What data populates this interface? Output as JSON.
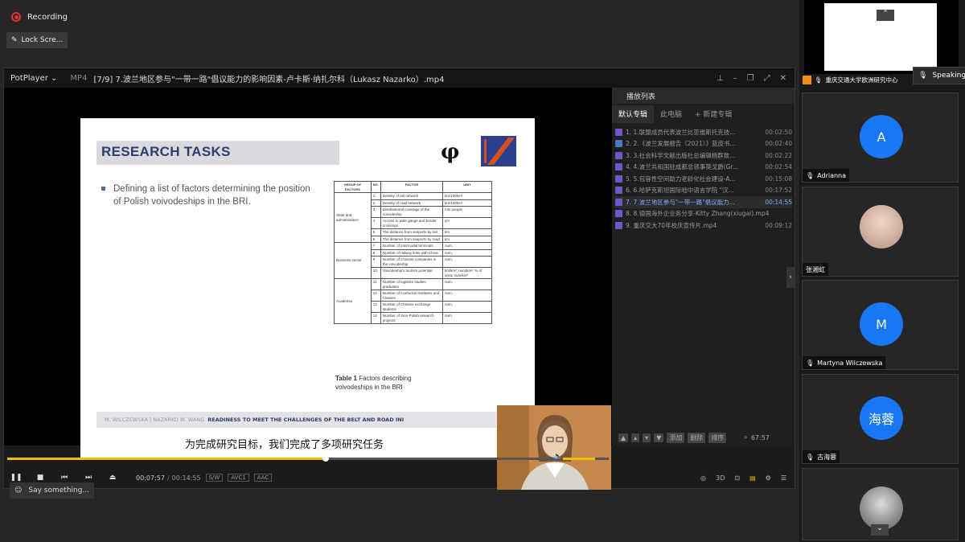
{
  "meeting": {
    "recording_label": "Recording",
    "lock_label": "Lock Scre...",
    "say_placeholder": "Say something...",
    "speaking_label": "Speaking"
  },
  "player": {
    "app_name": "PotPlayer",
    "format": "MP4",
    "title": "[7/9] 7.波兰地区参与\"一带一路\"倡议能力的影响因素-卢卡斯·纳扎尔科（Lukasz Nazarko）.mp4",
    "time_current": "00:07:57",
    "time_total": "00:14:55",
    "badges": [
      "S/W",
      "AVC1",
      "AAC"
    ],
    "progress_fraction": 0.53
  },
  "slide": {
    "heading": "RESEARCH TASKS",
    "bullet": "Defining a list of factors determining the position of Polish voivodeships in the BRI.",
    "table_headers": [
      "GROUP OF FACTORS",
      "NO.",
      "FACTOR",
      "UNIT"
    ],
    "groups": [
      "State and administration",
      "Business sector",
      "Academia"
    ],
    "rows": [
      [
        "1",
        "Density of rail network",
        "km/100km²"
      ],
      [
        "2",
        "Density of road network",
        "km/100km²"
      ],
      [
        "3",
        "Distributional coverage of the voivodeship",
        "mln people"
      ],
      [
        "4",
        "Access to wide gauge and border crossings",
        "y/n"
      ],
      [
        "5",
        "The distance from seaports by rail",
        "km"
      ],
      [
        "6",
        "The distance from seaports by road",
        "km"
      ],
      [
        "7",
        "Number of intermodal terminals",
        "num."
      ],
      [
        "8",
        "Number of railway links with China",
        "num."
      ],
      [
        "9",
        "Number of Chinese companies in the voivodeship",
        "num."
      ],
      [
        "10",
        "Voivodeship's tourism potential",
        "km/km²; num/km²; % of area; num/km²"
      ],
      [
        "11",
        "Number of logistics studies graduates",
        "num."
      ],
      [
        "12",
        "Number of Confucius Institutes and Classes",
        "num."
      ],
      [
        "13",
        "Number of Chinese exchange students",
        "num."
      ],
      [
        "14",
        "Number of Sino-Polish research projects",
        "num."
      ]
    ],
    "caption_bold": "Table 1",
    "caption": "Factors describing voivodeships in the BRI",
    "footer_authors": "M. WILCZEWSKA | NAZARKO M. WANG",
    "footer_title": "READINESS TO MEET THE CHALLENGES OF THE BELT AND ROAD INI",
    "subtitle": "为完成研究目标，我们完成了多项研究任务"
  },
  "playlist": {
    "title": "播放列表",
    "tabs": [
      "默认专辑",
      "此电脑",
      "+ 新建专辑"
    ],
    "items": [
      {
        "name": "1. 1.联盟成员代表波兰比亚维斯托克技...",
        "dur": "00:02:50",
        "doc": false
      },
      {
        "name": "2. 2.《波兰发展报告（2021）》蓝皮书...",
        "dur": "00:02:40",
        "doc": true
      },
      {
        "name": "3. 3.社会科学文献出版社总编辑杨群致...",
        "dur": "00:02:22",
        "doc": false
      },
      {
        "name": "4. 4.波兰共和国驻成都总领事莫戈爵(Gr...",
        "dur": "00:02:54",
        "doc": false
      },
      {
        "name": "5. 5.包容性空间助力老龄化社会建设-A...",
        "dur": "00:15:08",
        "doc": false
      },
      {
        "name": "6. 6.哈萨克斯坦国际咄中语言学院 \"汉...",
        "dur": "00:17:52",
        "doc": false
      },
      {
        "name": "7. 7.波兰地区参与\"一带一路\"倡议能力...",
        "dur": "00:14:55",
        "doc": false
      },
      {
        "name": "8. 8.德国海外企业务分享-Kitty Zhang(xiugai).mp4",
        "dur": "",
        "doc": false
      },
      {
        "name": "9. 重庆交大70年校庆宣传片.mp4",
        "dur": "00:09:12",
        "doc": false
      }
    ],
    "active_index": 6,
    "footer_buttons": [
      "添加",
      "删除",
      "排序"
    ],
    "footer_count": "67:57"
  },
  "participants": [
    {
      "name": "重庆交通大学欧洲研究中心",
      "kind": "share"
    },
    {
      "name": "Adrianna",
      "kind": "avatar",
      "initial": "A"
    },
    {
      "name": "张湘虹",
      "kind": "photo"
    },
    {
      "name": "Martyna Wilczewska",
      "kind": "avatar",
      "initial": "M"
    },
    {
      "name": "古海蓉",
      "kind": "avatar",
      "initial": "海蓉"
    },
    {
      "name": "",
      "kind": "photo"
    }
  ],
  "colors": {
    "avatar_blue": "#1877f2",
    "progress_yellow": "#e6c200",
    "playlist_active": "#7fb0ff"
  }
}
